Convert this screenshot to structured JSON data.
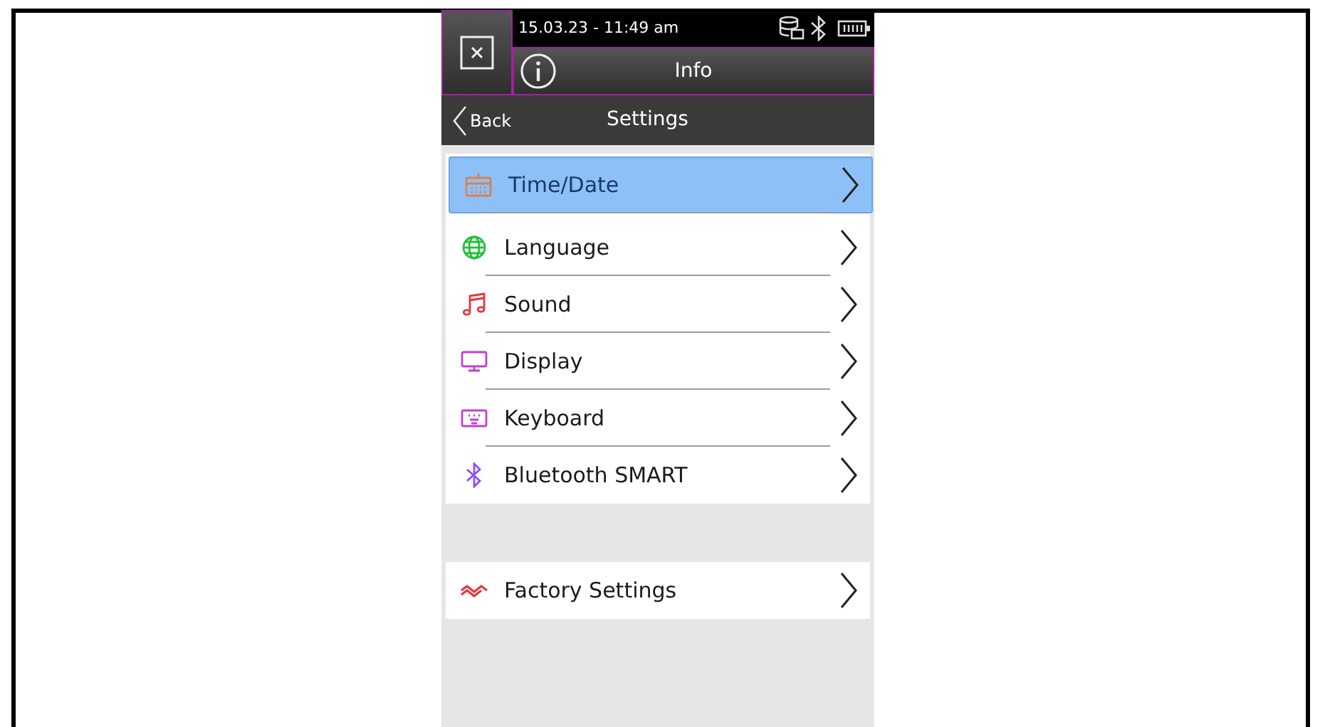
{
  "status_bar": {
    "datetime": "15.03.23 - 11:49 am"
  },
  "header": {
    "title": "Info"
  },
  "nav": {
    "back": "Back",
    "title": "Settings"
  },
  "settings_items": [
    {
      "label": "Time/Date",
      "selected": true
    },
    {
      "label": "Language",
      "selected": false
    },
    {
      "label": "Sound",
      "selected": false
    },
    {
      "label": "Display",
      "selected": false
    },
    {
      "label": "Keyboard",
      "selected": false
    },
    {
      "label": "Bluetooth SMART",
      "selected": false
    }
  ],
  "reset_items": [
    {
      "label": "Factory Settings",
      "selected": false
    }
  ]
}
